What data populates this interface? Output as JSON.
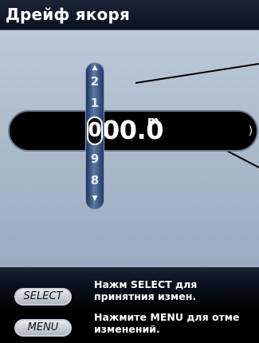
{
  "title": "Дрейф якоря",
  "value": {
    "number": "0",
    "rest": "00.0",
    "unit": "m"
  },
  "roller": {
    "digits_above": [
      "2",
      "1"
    ],
    "selected_digit": "0",
    "digits_below": [
      "9",
      "8"
    ]
  },
  "softkeys": [
    {
      "label": "SELECT",
      "hint": [
        "Нажм SELECT для",
        "принятния измен."
      ]
    },
    {
      "label": "MENU",
      "hint": [
        "Нажмите MENU для отме",
        "изменений."
      ]
    }
  ],
  "colors": {
    "title_bar": "#0a1220",
    "panel": "#a8b7c8",
    "roller": "#3c5a8a",
    "bar": "#000000"
  },
  "icons": {
    "roller_up": "triangle-up",
    "roller_down": "triangle-down",
    "bar_next": "chevron-right"
  }
}
